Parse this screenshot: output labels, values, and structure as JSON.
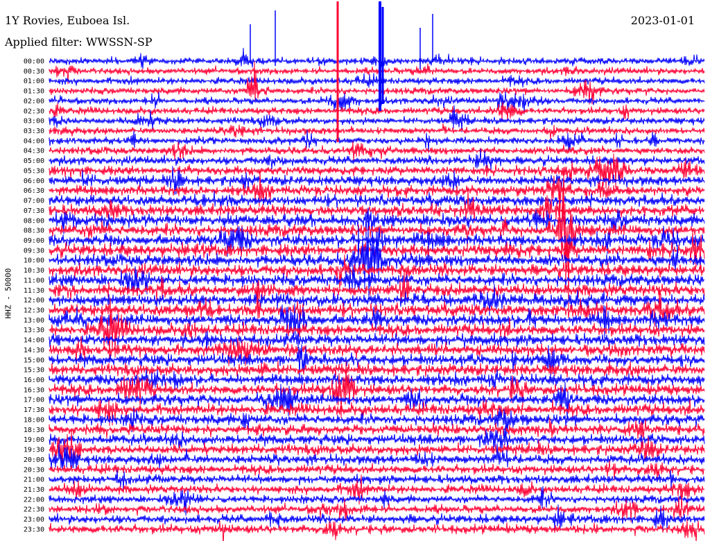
{
  "header": {
    "station": "1Y Rovies, Euboea Isl.",
    "filter": "Applied filter: WWSSN-SP",
    "date": "2023-01-01"
  },
  "chart_data": {
    "type": "line",
    "ylabel": "HHZ - 50000",
    "row_labels": [
      "00:00",
      "00:30",
      "01:00",
      "01:30",
      "02:00",
      "02:30",
      "03:00",
      "03:30",
      "04:00",
      "04:30",
      "05:00",
      "05:30",
      "06:00",
      "06:30",
      "07:00",
      "07:30",
      "08:00",
      "08:30",
      "09:00",
      "09:30",
      "10:00",
      "10:30",
      "11:00",
      "11:30",
      "12:00",
      "12:30",
      "13:00",
      "13:30",
      "14:00",
      "14:30",
      "15:00",
      "15:30",
      "16:00",
      "16:30",
      "17:00",
      "17:30",
      "18:00",
      "18:30",
      "19:00",
      "19:30",
      "20:00",
      "20:30",
      "21:00",
      "21:30",
      "22:00",
      "22:30",
      "23:00",
      "23:30"
    ],
    "colors": [
      "#0000ff",
      "#ff0033"
    ],
    "noise_level": [
      0.35,
      0.35,
      0.35,
      0.35,
      0.35,
      0.38,
      0.38,
      0.38,
      0.4,
      0.45,
      0.55,
      0.65,
      0.75,
      0.8,
      0.85,
      0.9,
      1.0,
      1.0,
      1.0,
      1.0,
      1.0,
      1.0,
      1.0,
      1.0,
      1.0,
      1.0,
      1.0,
      0.95,
      0.95,
      0.95,
      0.95,
      0.95,
      0.9,
      0.9,
      0.9,
      0.9,
      0.85,
      0.85,
      0.8,
      0.8,
      0.7,
      0.65,
      0.6,
      0.55,
      0.5,
      0.55,
      0.6,
      0.65
    ]
  }
}
